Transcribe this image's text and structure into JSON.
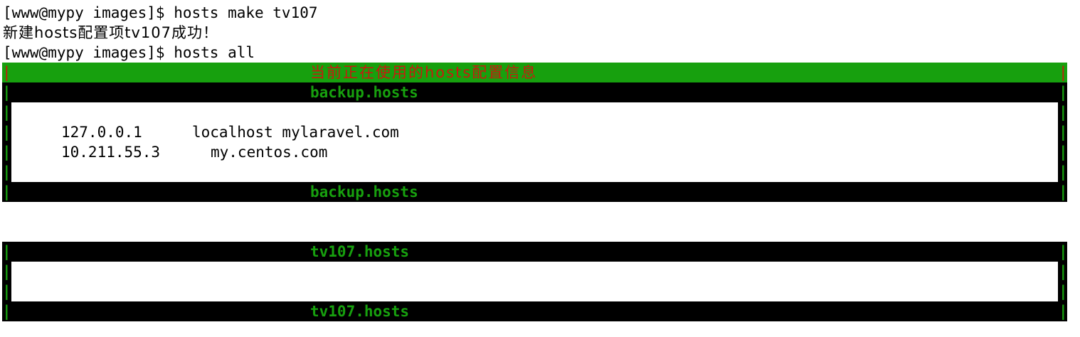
{
  "terminal": {
    "lines": [
      "[www@mypy images]$ hosts make tv107",
      "新建hosts配置项tv107成功！",
      "[www@mypy images]$ hosts all"
    ]
  },
  "current_header": {
    "title": "当前正在使用的hosts配置信息",
    "pipe": "|"
  },
  "blocks": [
    {
      "title": "backup.hosts",
      "pipe": "|",
      "entries": [
        {
          "ip": "127.0.0.1",
          "hosts": "localhost mylaravel.com"
        },
        {
          "ip": "10.211.55.3",
          "hosts": "my.centos.com"
        }
      ]
    },
    {
      "title": "tv107.hosts",
      "pipe": "|",
      "entries": []
    }
  ],
  "colors": {
    "header_bg": "#17a00e",
    "header_text": "#c81a0e",
    "title_text": "#17a00e",
    "bar_bg": "#000000"
  }
}
